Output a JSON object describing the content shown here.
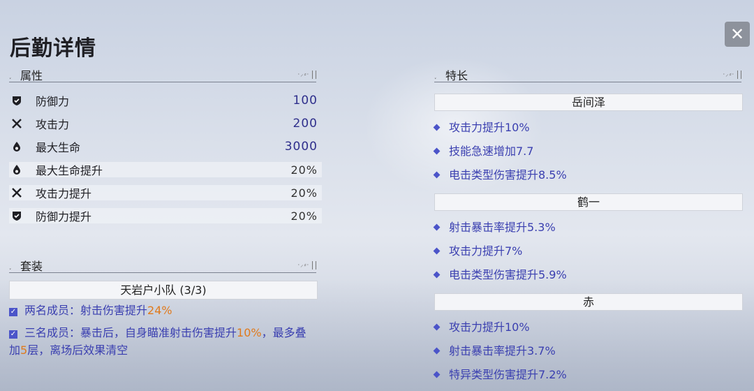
{
  "title": "后勤详情",
  "close_glyph": "✕",
  "attributes_section": {
    "label": "属性",
    "deco": "⸱⸝⸗⸱"
  },
  "attributes": [
    {
      "icon": "shield-icon",
      "label": "防御力",
      "value": "100"
    },
    {
      "icon": "cross-swords-icon",
      "label": "攻击力",
      "value": "200"
    },
    {
      "icon": "drop-icon",
      "label": "最大生命",
      "value": "3000"
    },
    {
      "icon": "drop-icon",
      "label": "最大生命提升",
      "value": "20%"
    },
    {
      "icon": "cross-swords-icon",
      "label": "攻击力提升",
      "value": "20%"
    },
    {
      "icon": "shield-icon",
      "label": "防御力提升",
      "value": "20%"
    }
  ],
  "set_section": {
    "label": "套装",
    "deco": "⸱⸝⸗⸱"
  },
  "set": {
    "name": "天岩户小队 (3/3)",
    "effects": [
      {
        "text_before": "两名成员：射击伤害提升",
        "highlight": "24%",
        "text_after": ""
      },
      {
        "text_before": "三名成员：暴击后，自身瞄准射击伤害提升",
        "highlight": "10%",
        "text_mid": "，最多叠加",
        "highlight2": "5",
        "text_after": "层，离场后效果清空"
      }
    ]
  },
  "specialty_section": {
    "label": "特长",
    "deco": "⸱⸝⸗⸱"
  },
  "specialties": [
    {
      "name": "岳间泽",
      "skills": [
        "攻击力提升10%",
        "技能急速增加7.7",
        "电击类型伤害提升8.5%"
      ]
    },
    {
      "name": "鹤一",
      "skills": [
        "射击暴击率提升5.3%",
        "攻击力提升7%",
        "电击类型伤害提升5.9%"
      ]
    },
    {
      "name": "赤",
      "skills": [
        "攻击力提升10%",
        "射击暴击率提升3.7%",
        "特异类型伤害提升7.2%"
      ]
    }
  ],
  "colors": {
    "accent": "#4b54c9",
    "value": "#2f2f8c",
    "highlight": "#e07a1c"
  }
}
